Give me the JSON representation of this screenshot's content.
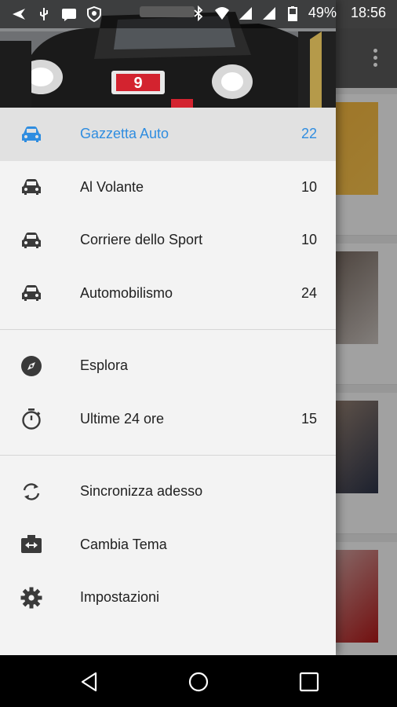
{
  "status_bar": {
    "battery": "49%",
    "time": "18:56"
  },
  "drawer": {
    "sources": [
      {
        "label": "Gazzetta Auto",
        "count": "22",
        "active": true,
        "icon": "car-icon"
      },
      {
        "label": "Al Volante",
        "count": "10",
        "active": false,
        "icon": "car-icon"
      },
      {
        "label": "Corriere dello Sport",
        "count": "10",
        "active": false,
        "icon": "car-icon"
      },
      {
        "label": "Automobilismo",
        "count": "24",
        "active": false,
        "icon": "car-icon"
      }
    ],
    "explore": [
      {
        "label": "Esplora",
        "count": "",
        "icon": "compass-icon"
      },
      {
        "label": "Ultime 24 ore",
        "count": "15",
        "icon": "stopwatch-icon"
      }
    ],
    "actions": [
      {
        "label": "Sincronizza adesso",
        "icon": "sync-icon"
      },
      {
        "label": "Cambia Tema",
        "icon": "theme-icon"
      },
      {
        "label": "Impostazioni",
        "icon": "settings-icon"
      }
    ]
  },
  "colors": {
    "accent": "#2f8de0",
    "drawer_bg": "#f3f3f3",
    "active_bg": "#e1e1e1",
    "text": "#212121"
  },
  "nav_bar": {
    "buttons": [
      "back-icon",
      "home-icon",
      "recents-icon"
    ]
  }
}
